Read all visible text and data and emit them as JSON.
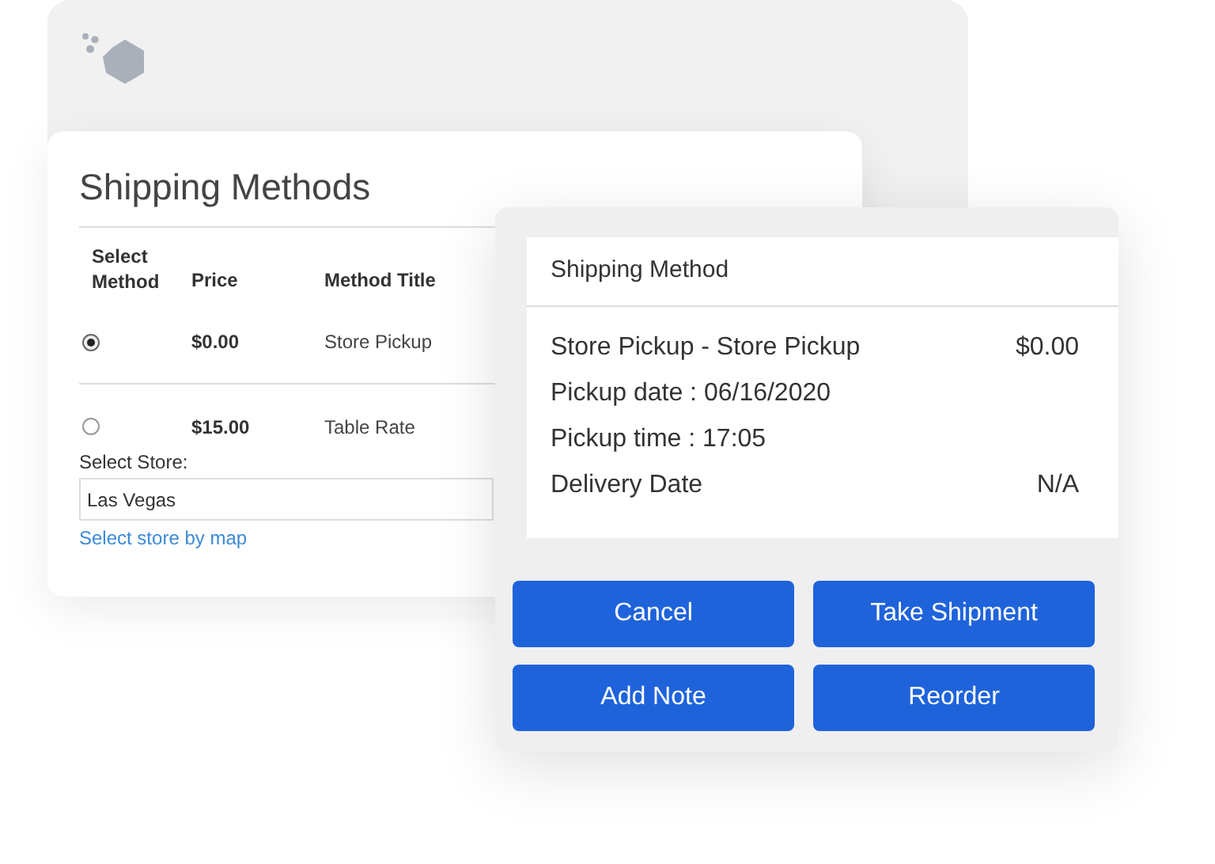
{
  "shipping_methods": {
    "title": "Shipping Methods",
    "columns": [
      "Select Method",
      "Price",
      "Method Title"
    ],
    "rows": [
      {
        "selected": true,
        "price": "$0.00",
        "method_title": "Store Pickup"
      },
      {
        "selected": false,
        "price": "$15.00",
        "method_title": "Table Rate"
      }
    ],
    "store_label": "Select Store:",
    "store_value": "Las Vegas",
    "map_link": "Select store by map"
  },
  "summary": {
    "title": "Shipping Method",
    "lines": [
      {
        "label": "Store Pickup - Store Pickup",
        "value": "$0.00"
      },
      {
        "label": "Pickup date : 06/16/2020"
      },
      {
        "label": "Pickup time : 17:05"
      },
      {
        "label": "Delivery Date",
        "value": "N/A"
      }
    ],
    "buttons": [
      "Cancel",
      "Take Shipment",
      "Add Note",
      "Reorder"
    ]
  }
}
